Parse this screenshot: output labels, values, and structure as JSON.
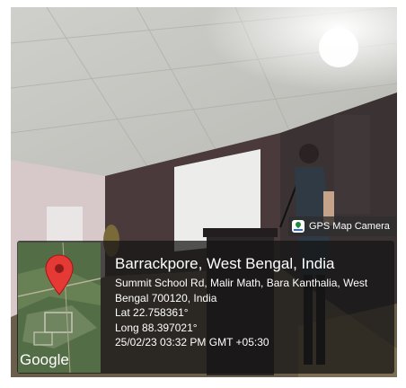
{
  "badge": {
    "label": "GPS Map Camera",
    "icon": "gps-map-camera-icon"
  },
  "map": {
    "attribution": "Google",
    "pin_color": "#e53935"
  },
  "location": {
    "title": "Barrackpore, West Bengal, India",
    "address_line1": "Summit School Rd, Malir Math, Bara Kanthalia, West",
    "address_line2": "Bengal 700120, India",
    "latitude": "Lat 22.758361°",
    "longitude": "Long 88.397021°",
    "datetime": "25/02/23 03:32 PM GMT +05:30"
  }
}
